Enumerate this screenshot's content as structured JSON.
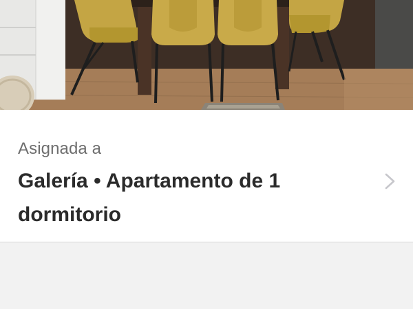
{
  "photo": {
    "icon": "dining-room-photo"
  },
  "assigned": {
    "caption": "Asignada a",
    "value": "Galería • Apartamento de 1 dormitorio",
    "chevron_icon": "chevron-right-icon"
  },
  "colors": {
    "card_background": "#ffffff",
    "page_background": "#f2f2f2",
    "caption_text": "#6e6e6e",
    "value_text": "#2b2b2b",
    "chevron": "#c7c7cc"
  }
}
